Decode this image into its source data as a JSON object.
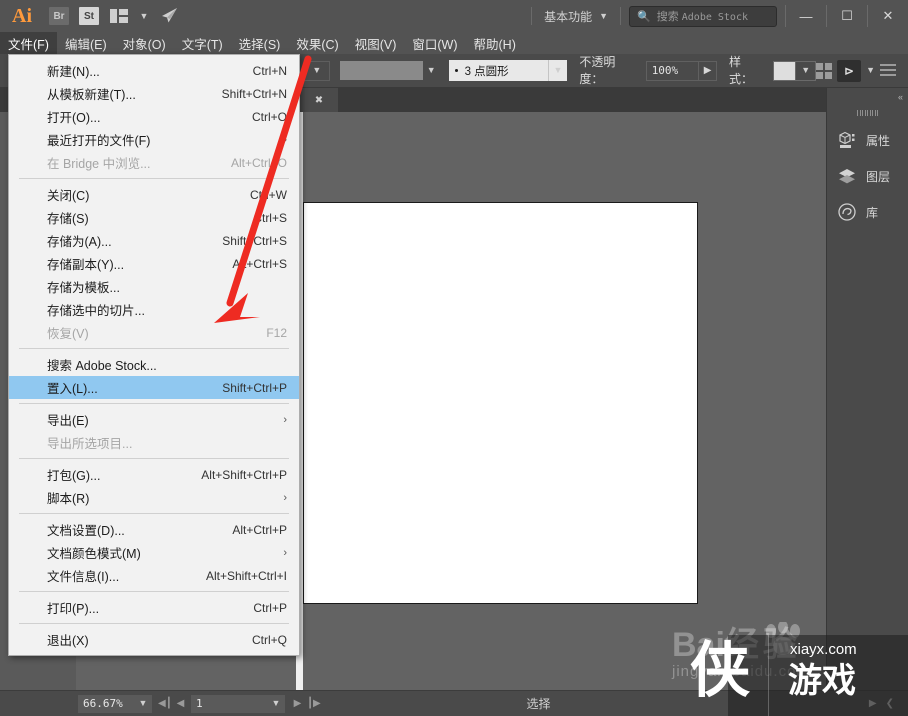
{
  "app": {
    "name": "Ai",
    "logo_text": "Ai"
  },
  "titlebar": {
    "icons": [
      {
        "name": "bridge-icon",
        "label": "Br"
      },
      {
        "name": "stock-icon",
        "label": "St"
      },
      {
        "name": "arrange-documents-icon",
        "label": ""
      },
      {
        "name": "rocket-icon",
        "label": "➤"
      }
    ],
    "workspace": "基本功能",
    "search": {
      "placeholder_cn": "搜索",
      "placeholder_en": "Adobe Stock"
    },
    "window_controls": {
      "minimize": "—",
      "maximize": "☐",
      "close": "✕"
    }
  },
  "menubar": {
    "items": [
      {
        "label": "文件(F)",
        "active": true
      },
      {
        "label": "编辑(E)",
        "active": false
      },
      {
        "label": "对象(O)",
        "active": false
      },
      {
        "label": "文字(T)",
        "active": false
      },
      {
        "label": "选择(S)",
        "active": false
      },
      {
        "label": "效果(C)",
        "active": false
      },
      {
        "label": "视图(V)",
        "active": false
      },
      {
        "label": "窗口(W)",
        "active": false
      },
      {
        "label": "帮助(H)",
        "active": false
      }
    ]
  },
  "controlbar": {
    "brush_label": "3 点圆形",
    "opacity_label": "不透明度：",
    "opacity_value": "100%",
    "style_label": "样式："
  },
  "filemenu": {
    "items": [
      {
        "label": "新建(N)...",
        "accel": "Ctrl+N",
        "disabled": false,
        "highlight": false,
        "submenu": false
      },
      {
        "label": "从模板新建(T)...",
        "accel": "Shift+Ctrl+N",
        "disabled": false,
        "highlight": false,
        "submenu": false
      },
      {
        "label": "打开(O)...",
        "accel": "Ctrl+O",
        "disabled": false,
        "highlight": false,
        "submenu": false
      },
      {
        "label": "最近打开的文件(F)",
        "accel": "",
        "disabled": false,
        "highlight": false,
        "submenu": true
      },
      {
        "label": "在 Bridge 中浏览...",
        "accel": "Alt+Ctrl+O",
        "disabled": true,
        "highlight": false,
        "submenu": false
      },
      {
        "separator": true
      },
      {
        "label": "关闭(C)",
        "accel": "Ctrl+W",
        "disabled": false,
        "highlight": false,
        "submenu": false
      },
      {
        "label": "存储(S)",
        "accel": "Ctrl+S",
        "disabled": false,
        "highlight": false,
        "submenu": false
      },
      {
        "label": "存储为(A)...",
        "accel": "Shift+Ctrl+S",
        "disabled": false,
        "highlight": false,
        "submenu": false
      },
      {
        "label": "存储副本(Y)...",
        "accel": "Alt+Ctrl+S",
        "disabled": false,
        "highlight": false,
        "submenu": false
      },
      {
        "label": "存储为模板...",
        "accel": "",
        "disabled": false,
        "highlight": false,
        "submenu": false
      },
      {
        "label": "存储选中的切片...",
        "accel": "",
        "disabled": false,
        "highlight": false,
        "submenu": false
      },
      {
        "label": "恢复(V)",
        "accel": "F12",
        "disabled": true,
        "highlight": false,
        "submenu": false
      },
      {
        "separator": true
      },
      {
        "label": "搜索 Adobe Stock...",
        "accel": "",
        "disabled": false,
        "highlight": false,
        "submenu": false
      },
      {
        "label": "置入(L)...",
        "accel": "Shift+Ctrl+P",
        "disabled": false,
        "highlight": true,
        "submenu": false
      },
      {
        "separator": true
      },
      {
        "label": "导出(E)",
        "accel": "",
        "disabled": false,
        "highlight": false,
        "submenu": true
      },
      {
        "label": "导出所选项目...",
        "accel": "",
        "disabled": true,
        "highlight": false,
        "submenu": false
      },
      {
        "separator": true
      },
      {
        "label": "打包(G)...",
        "accel": "Alt+Shift+Ctrl+P",
        "disabled": false,
        "highlight": false,
        "submenu": false
      },
      {
        "label": "脚本(R)",
        "accel": "",
        "disabled": false,
        "highlight": false,
        "submenu": true
      },
      {
        "separator": true
      },
      {
        "label": "文档设置(D)...",
        "accel": "Alt+Ctrl+P",
        "disabled": false,
        "highlight": false,
        "submenu": false
      },
      {
        "label": "文档颜色模式(M)",
        "accel": "",
        "disabled": false,
        "highlight": false,
        "submenu": true
      },
      {
        "label": "文件信息(I)...",
        "accel": "Alt+Shift+Ctrl+I",
        "disabled": false,
        "highlight": false,
        "submenu": false
      },
      {
        "separator": true
      },
      {
        "label": "打印(P)...",
        "accel": "Ctrl+P",
        "disabled": false,
        "highlight": false,
        "submenu": false
      },
      {
        "separator": true
      },
      {
        "label": "退出(X)",
        "accel": "Ctrl+Q",
        "disabled": false,
        "highlight": false,
        "submenu": false
      }
    ]
  },
  "rightdock": {
    "collapse_icon": "«",
    "panels": [
      {
        "label": "属性",
        "icon": "properties-icon"
      },
      {
        "label": "图层",
        "icon": "layers-icon"
      },
      {
        "label": "库",
        "icon": "libraries-icon"
      }
    ]
  },
  "statusbar": {
    "zoom": "66.67%",
    "page": "1",
    "status_text": "选择"
  },
  "watermarks": {
    "baidu_big": "Bai",
    "baidu_cn": "经验",
    "baidu_url": "jingyan.baidu.com",
    "xia_char": "侠",
    "xia_site": "xiayx.com",
    "xia_game": "游戏"
  },
  "annotation": {
    "arrow_color": "#ee2b22"
  }
}
